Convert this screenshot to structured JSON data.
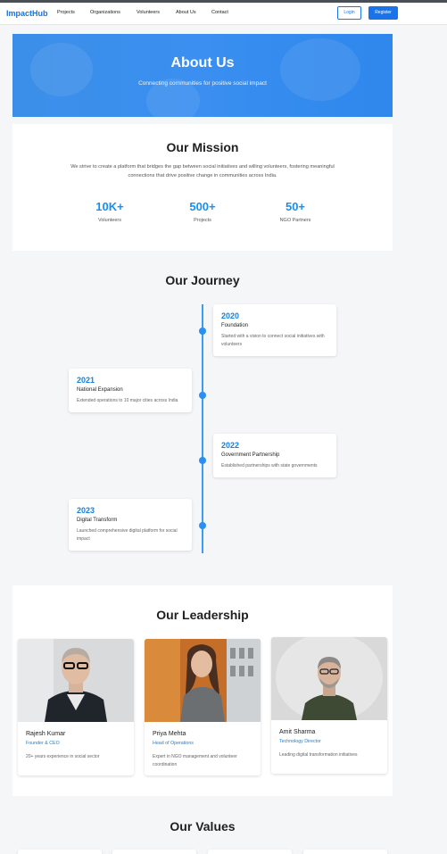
{
  "brand": "ImpactHub",
  "nav": {
    "links": [
      "Projects",
      "Organizations",
      "Volunteers",
      "About Us",
      "Contact"
    ],
    "login": "Login",
    "register": "Register"
  },
  "hero": {
    "title": "About Us",
    "subtitle": "Connecting communities for positive social impact"
  },
  "mission": {
    "title": "Our Mission",
    "text": "We strive to create a platform that bridges the gap between social initiatives and willing volunteers, fostering meaningful connections that drive positive change in communities across India.",
    "stats": [
      {
        "value": "10K+",
        "label": "Volunteers"
      },
      {
        "value": "500+",
        "label": "Projects"
      },
      {
        "value": "50+",
        "label": "NGO Partners"
      }
    ]
  },
  "journey": {
    "title": "Our Journey",
    "items": [
      {
        "year": "2020",
        "heading": "Foundation",
        "desc": "Started with a vision to connect social initiatives with volunteers"
      },
      {
        "year": "2021",
        "heading": "National Expansion",
        "desc": "Extended operations to 10 major cities across India"
      },
      {
        "year": "2022",
        "heading": "Government Partnership",
        "desc": "Established partnerships with state governments"
      },
      {
        "year": "2023",
        "heading": "Digital Transform",
        "desc": "Launched comprehensive digital platform for social impact"
      }
    ]
  },
  "leadership": {
    "title": "Our Leadership",
    "members": [
      {
        "name": "Rajesh Kumar",
        "role": "Founder & CEO",
        "desc": "20+ years experience in social sector"
      },
      {
        "name": "Priya Mehta",
        "role": "Head of Operations",
        "desc": "Expert in NGO management and volunteer coordination"
      },
      {
        "name": "Amit Sharma",
        "role": "Technology Director",
        "desc": "Leading digital transformation initiatives"
      }
    ]
  },
  "values": {
    "title": "Our Values"
  },
  "colors": {
    "accent": "#1a73e8",
    "stat_blue": "#1a8ff0",
    "hero_blue": "#3a8ff0"
  }
}
